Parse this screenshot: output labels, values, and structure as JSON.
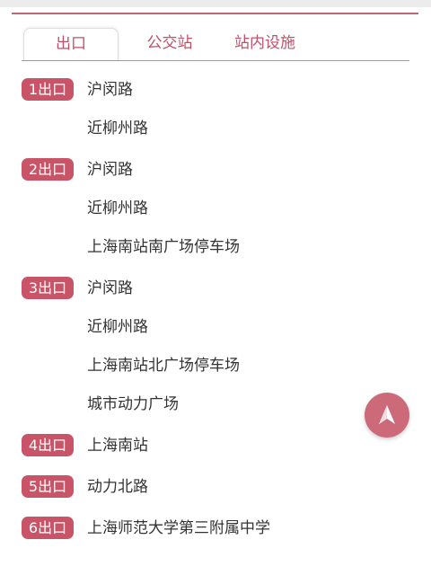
{
  "tabs": [
    {
      "label": "出口",
      "active": true
    },
    {
      "label": "公交站",
      "active": false
    },
    {
      "label": "站内设施",
      "active": false
    }
  ],
  "exits": [
    {
      "badge": "1出口",
      "destinations": [
        "沪闵路",
        "近柳州路"
      ]
    },
    {
      "badge": "2出口",
      "destinations": [
        "沪闵路",
        "近柳州路",
        "上海南站南广场停车场"
      ]
    },
    {
      "badge": "3出口",
      "destinations": [
        "沪闵路",
        "近柳州路",
        "上海南站北广场停车场",
        "城市动力广场"
      ]
    },
    {
      "badge": "4出口",
      "destinations": [
        "上海南站"
      ]
    },
    {
      "badge": "5出口",
      "destinations": [
        "动力北路"
      ]
    },
    {
      "badge": "6出口",
      "destinations": [
        "上海师范大学第三附属中学"
      ]
    }
  ],
  "fab": {
    "icon": "navigation-arrow-icon"
  },
  "colors": {
    "accent": "#c95468",
    "tab_text": "#c0506a",
    "text": "#333333",
    "fab": "#cd6a7a"
  }
}
